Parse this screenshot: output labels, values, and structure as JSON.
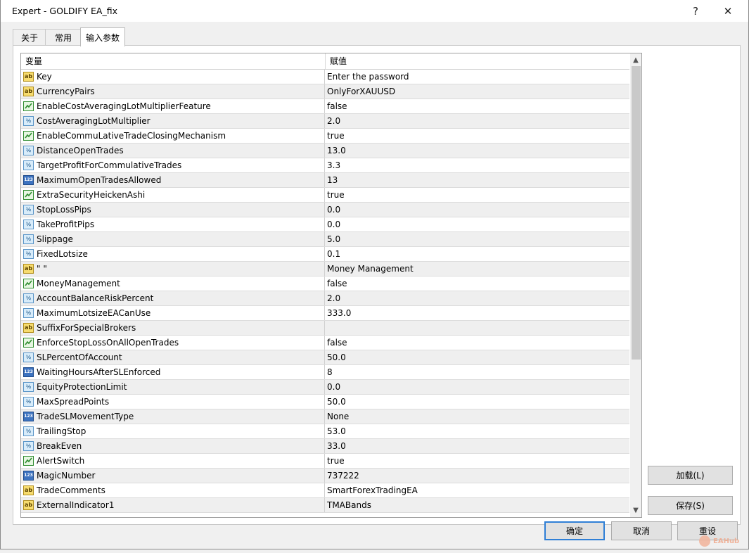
{
  "window": {
    "title": "Expert - GOLDIFY EA_fix",
    "help": "?",
    "close": "✕"
  },
  "tabs": [
    {
      "label": "关于"
    },
    {
      "label": "常用"
    },
    {
      "label": "输入参数"
    }
  ],
  "grid": {
    "headers": {
      "name": "变量",
      "value": "赋值"
    },
    "rows": [
      {
        "type": "str",
        "name": "Key",
        "value": "Enter the password"
      },
      {
        "type": "str",
        "name": "CurrencyPairs",
        "value": " OnlyForXAUUSD"
      },
      {
        "type": "bool",
        "name": "EnableCostAveragingLotMultiplierFeature",
        "value": "false"
      },
      {
        "type": "dbl",
        "name": "CostAveragingLotMultiplier",
        "value": "2.0"
      },
      {
        "type": "bool",
        "name": "EnableCommuLativeTradeClosingMechanism",
        "value": "true"
      },
      {
        "type": "dbl",
        "name": "DistanceOpenTrades",
        "value": "13.0"
      },
      {
        "type": "dbl",
        "name": "TargetProfitForCommulativeTrades",
        "value": "3.3"
      },
      {
        "type": "int",
        "name": "MaximumOpenTradesAllowed",
        "value": "13"
      },
      {
        "type": "bool",
        "name": "ExtraSecurityHeickenAshi",
        "value": "true"
      },
      {
        "type": "dbl",
        "name": "StopLossPips",
        "value": "0.0"
      },
      {
        "type": "dbl",
        "name": "TakeProfitPips",
        "value": "0.0"
      },
      {
        "type": "dbl",
        "name": "Slippage",
        "value": "5.0"
      },
      {
        "type": "dbl",
        "name": "FixedLotsize",
        "value": "0.1"
      },
      {
        "type": "str",
        "name": "\" \"",
        "value": "Money Management"
      },
      {
        "type": "bool",
        "name": "MoneyManagement",
        "value": "false"
      },
      {
        "type": "dbl",
        "name": "AccountBalanceRiskPercent",
        "value": "2.0"
      },
      {
        "type": "dbl",
        "name": "MaximumLotsizeEACanUse",
        "value": "333.0"
      },
      {
        "type": "str",
        "name": "SuffixForSpecialBrokers",
        "value": ""
      },
      {
        "type": "bool",
        "name": "EnforceStopLossOnAllOpenTrades",
        "value": "false"
      },
      {
        "type": "dbl",
        "name": "SLPercentOfAccount",
        "value": "50.0"
      },
      {
        "type": "int",
        "name": "WaitingHoursAfterSLEnforced",
        "value": "8"
      },
      {
        "type": "dbl",
        "name": "EquityProtectionLimit",
        "value": "0.0"
      },
      {
        "type": "dbl",
        "name": "MaxSpreadPoints",
        "value": "50.0"
      },
      {
        "type": "int",
        "name": "TradeSLMovementType",
        "value": "None"
      },
      {
        "type": "dbl",
        "name": "TrailingStop",
        "value": "53.0"
      },
      {
        "type": "dbl",
        "name": "BreakEven",
        "value": "33.0"
      },
      {
        "type": "bool",
        "name": "AlertSwitch",
        "value": "true"
      },
      {
        "type": "int",
        "name": "MagicNumber",
        "value": "737222"
      },
      {
        "type": "str",
        "name": "TradeComments",
        "value": "SmartForexTradingEA"
      },
      {
        "type": "str",
        "name": "ExternalIndicator1",
        "value": "TMABands"
      }
    ]
  },
  "icon_glyphs": {
    "str": "ab",
    "dbl": "½",
    "int": "123",
    "bool": ""
  },
  "buttons": {
    "load": "加载(L)",
    "save": "保存(S)",
    "ok": "确定",
    "cancel": "取消",
    "reset": "重设"
  },
  "watermark": {
    "text": "EAHub"
  },
  "colors": {
    "accent": "#2f7fd6",
    "bool_icon": "#2f8c2f",
    "string_icon": "#f7dc6f"
  }
}
